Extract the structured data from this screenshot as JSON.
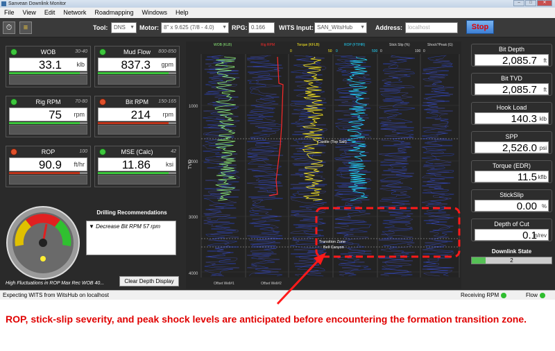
{
  "window": {
    "title": "Sanvean Downlink Monitor"
  },
  "menu": [
    "File",
    "View",
    "Edit",
    "Network",
    "Roadmapping",
    "Windows",
    "Help"
  ],
  "toolbar": {
    "tool_label": "Tool:",
    "tool_value": "DNS",
    "motor_label": "Motor:",
    "motor_value": "8\" x 9.625 (7/8 - 4.0)",
    "rpg_label": "RPG:",
    "rpg_value": "0.166",
    "wits_label": "WITS Input:",
    "wits_value": "SAN_WitsHub",
    "address_label": "Address:",
    "address_placeholder": "localhost",
    "stop_label": "Stop"
  },
  "gauges": [
    {
      "name": "WOB",
      "range": "30-40",
      "value": "33.1",
      "unit": "klb",
      "status": "green",
      "level": 0.9
    },
    {
      "name": "Mud Flow",
      "range": "800-850",
      "value": "837.3",
      "unit": "gpm",
      "status": "green",
      "level": 0.9
    },
    {
      "name": "Rig RPM",
      "range": "70-80",
      "value": "75",
      "unit": "rpm",
      "status": "green",
      "level": 0.9
    },
    {
      "name": "Bit RPM",
      "range": "150-165",
      "value": "214",
      "unit": "rpm",
      "status": "red",
      "level": 0.9
    },
    {
      "name": "ROP",
      "range": "100",
      "value": "90.9",
      "unit": "ft/hr",
      "status": "red",
      "level": 0.9
    },
    {
      "name": "MSE (Calc)",
      "range": "42",
      "value": "11.86",
      "unit": "ksi",
      "status": "green",
      "level": 0.9
    }
  ],
  "recommendations": {
    "title": "Drilling Recommendations",
    "item": "▼ Decrease Bit RPM 57 rpm"
  },
  "fluctuation_note": "High Fluctuations in ROP Max Rec WOB 40...",
  "clear_depth_label": "Clear Depth Display",
  "plot": {
    "track_headers": [
      "WOB (KLB)",
      "Rig RPM",
      "Torque (KFLB)",
      "ROP (FT/HR)",
      "Stick Slip (%)",
      "Shock?Peak (G)"
    ],
    "scale_labels": [
      "0",
      "50",
      "0",
      "500",
      "0",
      "100",
      "0"
    ],
    "depth_label": "TVD",
    "depth_ticks": [
      "1000",
      "2000",
      "3000",
      "4000"
    ],
    "formations": [
      "Castile (Top Salt)",
      "Transition Zone",
      "Bell Canyon"
    ],
    "legend": [
      "Offset Well#1",
      "Offset Well#2"
    ],
    "colors": {
      "wob": "#8ef07a",
      "rpm": "#ff2a2a",
      "torque": "#ffee22",
      "rop": "#22d8ff",
      "offset1": "#3050ff",
      "offset2": "#5060ff",
      "highlight": "#ff1a1a"
    }
  },
  "readouts": [
    {
      "label": "Bit Depth",
      "value": "2,085.7",
      "unit": "ft"
    },
    {
      "label": "Bit TVD",
      "value": "2,085.7",
      "unit": "ft"
    },
    {
      "label": "Hook Load",
      "value": "140.3",
      "unit": "klb"
    },
    {
      "label": "SPP",
      "value": "2,526.0",
      "unit": "psi"
    },
    {
      "label": "Torque (EDR)",
      "value": "11.5",
      "unit": "kflb"
    },
    {
      "label": "StickSlip",
      "value": "0.00",
      "unit": "%"
    },
    {
      "label": "Depth of Cut",
      "value": "0.1",
      "unit": "in/rev"
    }
  ],
  "downlink": {
    "label": "Downlink State",
    "value": "2"
  },
  "status": {
    "left": "Expecting WITS from WitsHub on localhost",
    "rpm": "Receiving RPM",
    "flow": "Flow"
  },
  "caption": "ROP, stick-slip severity, and peak shock levels are anticipated before encountering the formation transition zone."
}
